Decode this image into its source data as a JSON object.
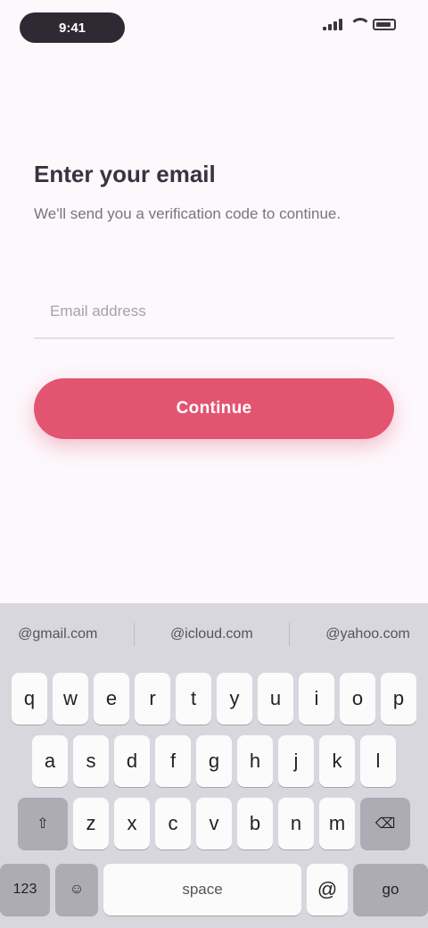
{
  "status_bar": {
    "time": "9:41",
    "icons": [
      "cellular-signal-icon",
      "wifi-icon",
      "battery-icon"
    ]
  },
  "screen": {
    "title": "Enter your email",
    "subtitle": "We'll send you a verification code to continue.",
    "email_input": {
      "value": "",
      "placeholder": "Email address"
    },
    "continue_label": "Continue"
  },
  "keyboard": {
    "suggestions": [
      "@gmail.com",
      "@icloud.com",
      "@yahoo.com"
    ],
    "row1": [
      "q",
      "w",
      "e",
      "r",
      "t",
      "y",
      "u",
      "i",
      "o",
      "p"
    ],
    "row2": [
      "a",
      "s",
      "d",
      "f",
      "g",
      "h",
      "j",
      "k",
      "l"
    ],
    "row3": [
      "z",
      "x",
      "c",
      "v",
      "b",
      "n",
      "m"
    ],
    "numbers_label": "123",
    "space_label": "space",
    "at_label": "@",
    "dot_label": ".",
    "go_label": "go",
    "icons": [
      "shift-icon",
      "backspace-icon",
      "globe-icon",
      "microphone-icon",
      "emoji-icon"
    ]
  },
  "colors": {
    "accent": "#e25470",
    "background": "#fdf8fc",
    "keyboard": "#d8d7de"
  }
}
